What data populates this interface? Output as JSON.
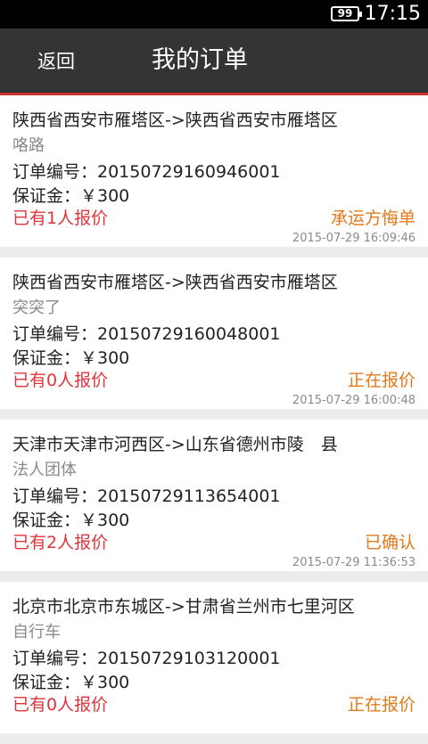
{
  "status_bar": {
    "battery": "99",
    "time": "17:15"
  },
  "header": {
    "back_label": "返回",
    "title": "我的订单"
  },
  "orders": [
    {
      "route": "陕西省西安市雁塔区->陕西省西安市雁塔区",
      "goods": "咯路",
      "order_no": "订单编号：2015072916094​6001",
      "deposit": "保证金：￥300",
      "quotes": "已有1人报价",
      "status": "承运方悔单",
      "time": "2015-07-29 16:09:46"
    },
    {
      "route": "陕西省西安市雁塔区->陕西省西安市雁塔区",
      "goods": "突突了",
      "order_no": "订单编号：20150729160048001",
      "deposit": "保证金：￥300",
      "quotes": "已有0人报价",
      "status": "正在报价",
      "time": "2015-07-29 16:00:48"
    },
    {
      "route": "天津市天津市河西区->山东省德州市陵　县",
      "goods": "法人团体",
      "order_no": "订单编号：20150729113654001",
      "deposit": "保证金：￥300",
      "quotes": "已有2人报价",
      "status": "已确认",
      "time": "2015-07-29 11:36:53"
    },
    {
      "route": "北京市北京市东城区->甘肃省兰州市七里河区",
      "goods": "自行车",
      "order_no": "订单编号：20150729103120001",
      "deposit": "保证金：￥300",
      "quotes": "已有0人报价",
      "status": "正在报价",
      "time": ""
    }
  ],
  "colors": {
    "header_bg": "#333435",
    "header_accent": "#c9302c",
    "quote_red": "#e0343c",
    "status_orange": "#e07a1a"
  }
}
